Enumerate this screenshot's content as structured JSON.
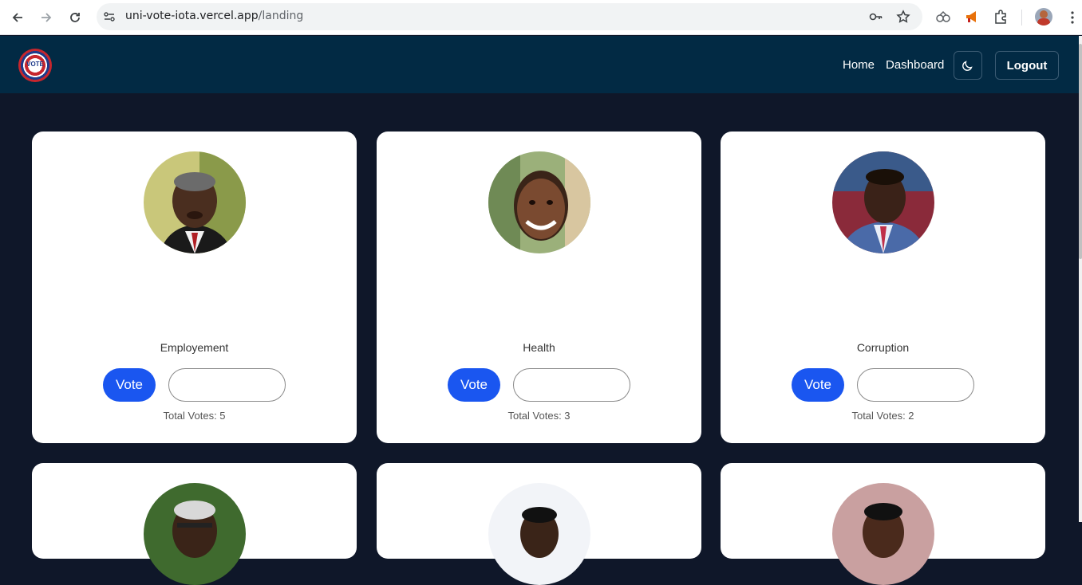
{
  "browser": {
    "url_host": "uni-vote-iota.vercel.app",
    "url_path": "/landing"
  },
  "header": {
    "logo_text": "VOTE",
    "nav": [
      {
        "label": "Home"
      },
      {
        "label": "Dashboard"
      }
    ],
    "logout_label": "Logout"
  },
  "candidates": [
    {
      "category": "Employement",
      "vote_label": "Vote",
      "total_votes": "Total Votes: 5"
    },
    {
      "category": "Health",
      "vote_label": "Vote",
      "total_votes": "Total Votes: 3"
    },
    {
      "category": "Corruption",
      "vote_label": "Vote",
      "total_votes": "Total Votes: 2"
    }
  ],
  "colors": {
    "page_bg": "#0f1729",
    "header_bg": "#022a44",
    "vote_button": "#1a56f0"
  }
}
